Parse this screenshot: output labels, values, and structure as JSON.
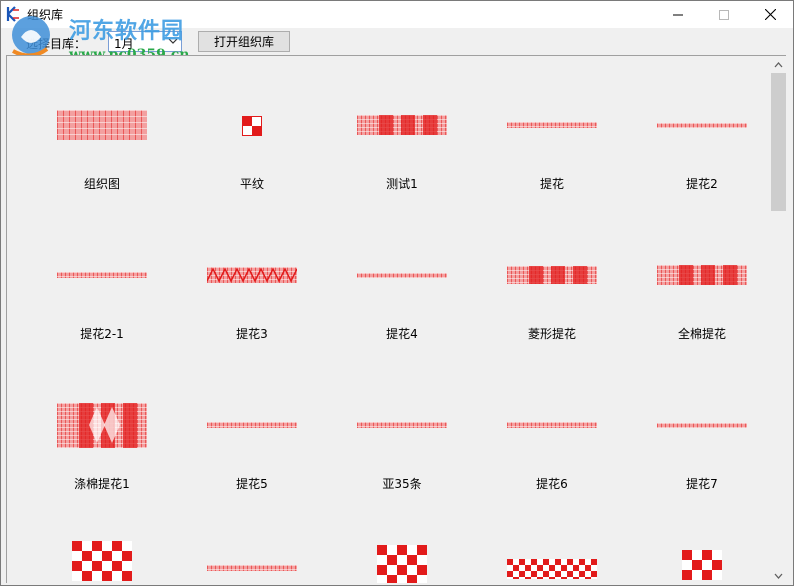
{
  "window": {
    "title": "组织库"
  },
  "watermark": {
    "name": "河东软件园",
    "url": "www.pc0359.cn"
  },
  "toolbar": {
    "select_label": "选择目库：",
    "select_value": "1月",
    "open_button": "打开组织库"
  },
  "library": {
    "items": [
      {
        "label": "组织图",
        "pattern": "wide-pink"
      },
      {
        "label": "平纹",
        "pattern": "checker-small"
      },
      {
        "label": "测试1",
        "pattern": "dense-band"
      },
      {
        "label": "提花",
        "pattern": "thin-band"
      },
      {
        "label": "提花2",
        "pattern": "thin-band-light"
      },
      {
        "label": "提花2-1",
        "pattern": "thin-band"
      },
      {
        "label": "提花3",
        "pattern": "zigzag-band"
      },
      {
        "label": "提花4",
        "pattern": "thin-band-light"
      },
      {
        "label": "菱形提花",
        "pattern": "medium-band"
      },
      {
        "label": "全棉提花",
        "pattern": "dense-band"
      },
      {
        "label": "涤棉提花1",
        "pattern": "tall-diamond"
      },
      {
        "label": "提花5",
        "pattern": "thin-band"
      },
      {
        "label": "亚35条",
        "pattern": "thin-band"
      },
      {
        "label": "提花6",
        "pattern": "thin-band"
      },
      {
        "label": "提花7",
        "pattern": "thin-band-light"
      }
    ],
    "partial_row_patterns": [
      "big-checker",
      "thin-band",
      "grid-checker",
      "row-checker",
      "small-checker-2"
    ]
  },
  "colors": {
    "accent_red": "#e21b1b",
    "pink": "#f3a0a0",
    "window_bg": "#f0f0f0"
  }
}
